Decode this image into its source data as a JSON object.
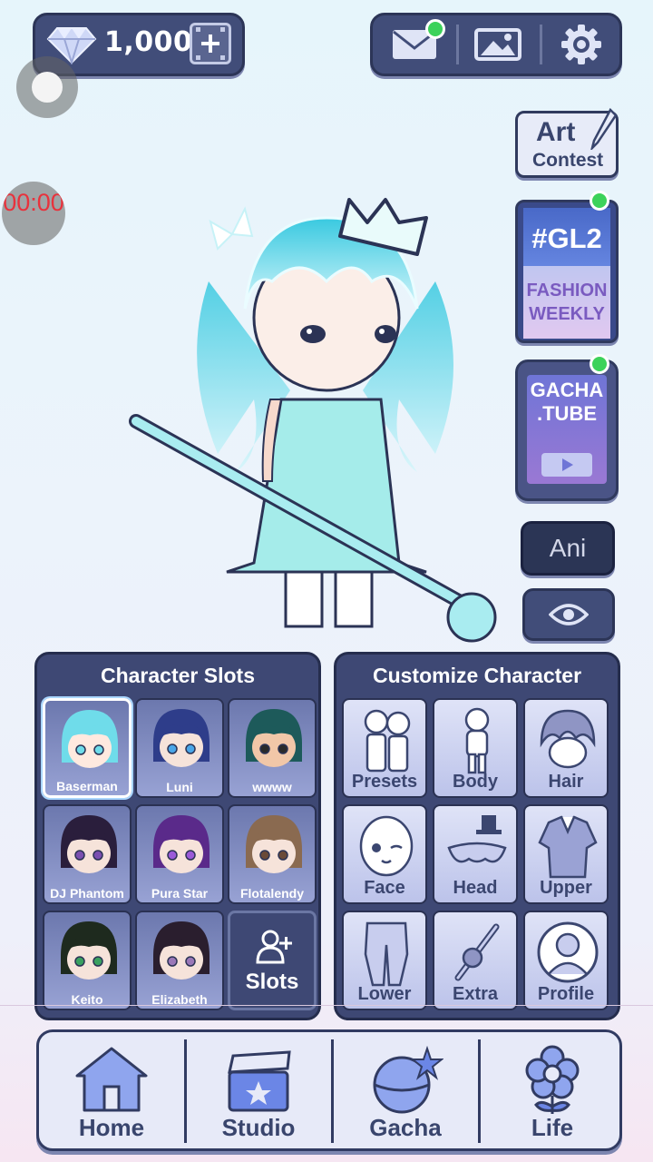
{
  "currency": {
    "amount": "1,000"
  },
  "timer": {
    "text": "00:00"
  },
  "side": {
    "art_line1": "Art",
    "art_line2": "Contest",
    "gl2_title": "#GL2",
    "gl2_line1": "FASHION",
    "gl2_line2": "WEEKLY",
    "tube_line1": "GACHA",
    "tube_line2": ".TUBE",
    "ani_label": "Ani"
  },
  "slots_panel": {
    "title": "Character Slots",
    "slots": [
      {
        "name": "Baserman",
        "hair": "#6fdcea",
        "skin": "#ffe9df",
        "eyes": "#6fdcea",
        "selected": true
      },
      {
        "name": "Luni",
        "hair": "#2e3d8a",
        "skin": "#f6e3da",
        "eyes": "#4aa6e8"
      },
      {
        "name": "wwww",
        "hair": "#1d5a5a",
        "skin": "#f1c7a8",
        "eyes": "#2a2a2a"
      },
      {
        "name": "DJ Phantom",
        "hair": "#2a1e3c",
        "skin": "#f6e3da",
        "eyes": "#7a4fb0"
      },
      {
        "name": "Pura Star",
        "hair": "#5a2a8a",
        "skin": "#f6e3da",
        "eyes": "#9a5ad8"
      },
      {
        "name": "Flotalendy",
        "hair": "#8a6a50",
        "skin": "#f6e3da",
        "eyes": "#6a4a38"
      },
      {
        "name": "Keito",
        "hair": "#1e2a1e",
        "skin": "#f6e3da",
        "eyes": "#3aa060"
      },
      {
        "name": "Elizabeth",
        "hair": "#2a1e2e",
        "skin": "#f6e3da",
        "eyes": "#9a78b8"
      }
    ],
    "add_label": "Slots"
  },
  "customize_panel": {
    "title": "Customize Character",
    "items": [
      "Presets",
      "Body",
      "Hair",
      "Face",
      "Head",
      "Upper",
      "Lower",
      "Extra",
      "Profile"
    ]
  },
  "bottom_nav": [
    "Home",
    "Studio",
    "Gacha",
    "Life"
  ],
  "colors": {
    "navy": "#414d79",
    "accent_green": "#3cd25a",
    "timer_red": "#e8323c"
  }
}
